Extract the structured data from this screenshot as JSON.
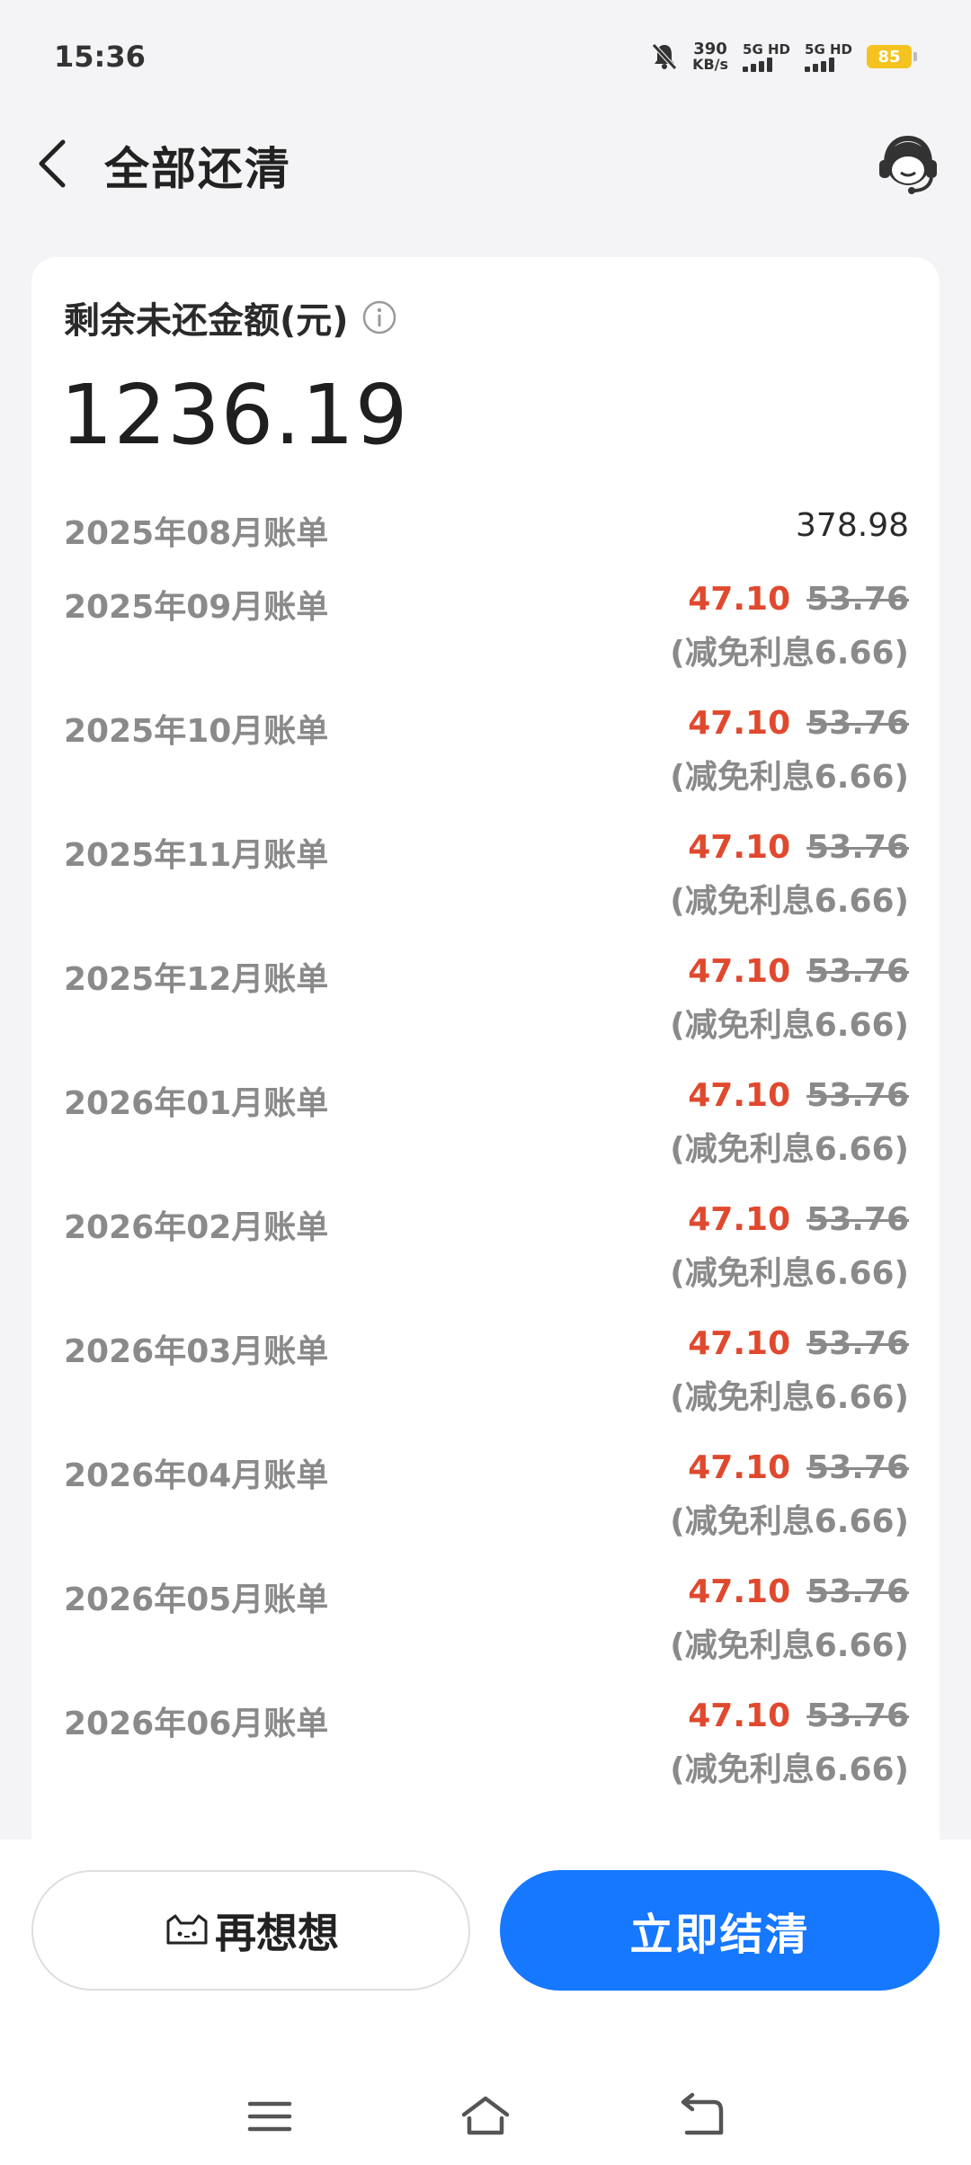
{
  "status_bar": {
    "time": "15:36",
    "net_speed_value": "390",
    "net_speed_unit": "KB/s",
    "sim1_label": "5G HD",
    "sim2_label": "5G HD",
    "battery": "85",
    "icons": [
      "mute-bell-icon",
      "signal-icon",
      "battery-icon"
    ]
  },
  "header": {
    "title": "全部还清",
    "back_icon": "chevron-left-icon",
    "service_icon": "customer-service-icon"
  },
  "balance": {
    "label": "剩余未还金额(元)",
    "amount": "1236.19",
    "info_icon": "info-icon"
  },
  "bills": [
    {
      "month": "2025年08月账单",
      "amount": "378.98"
    },
    {
      "month": "2025年09月账单",
      "amount": "47.10",
      "original": "53.76",
      "saving": "(减免利息6.66)"
    },
    {
      "month": "2025年10月账单",
      "amount": "47.10",
      "original": "53.76",
      "saving": "(减免利息6.66)"
    },
    {
      "month": "2025年11月账单",
      "amount": "47.10",
      "original": "53.76",
      "saving": "(减免利息6.66)"
    },
    {
      "month": "2025年12月账单",
      "amount": "47.10",
      "original": "53.76",
      "saving": "(减免利息6.66)"
    },
    {
      "month": "2026年01月账单",
      "amount": "47.10",
      "original": "53.76",
      "saving": "(减免利息6.66)"
    },
    {
      "month": "2026年02月账单",
      "amount": "47.10",
      "original": "53.76",
      "saving": "(减免利息6.66)"
    },
    {
      "month": "2026年03月账单",
      "amount": "47.10",
      "original": "53.76",
      "saving": "(减免利息6.66)"
    },
    {
      "month": "2026年04月账单",
      "amount": "47.10",
      "original": "53.76",
      "saving": "(减免利息6.66)"
    },
    {
      "month": "2026年05月账单",
      "amount": "47.10",
      "original": "53.76",
      "saving": "(减免利息6.66)"
    },
    {
      "month": "2026年06月账单",
      "amount": "47.10",
      "original": "53.76",
      "saving": "(减免利息6.66)"
    }
  ],
  "actions": {
    "later_label": "再想想",
    "settle_label": "立即结清",
    "later_icon": "cat-face-icon"
  },
  "colors": {
    "accent": "#1677ff",
    "discount": "#e0492e",
    "muted": "#8a8a8a",
    "battery": "#f5c320"
  },
  "nav": {
    "icons": [
      "menu-icon",
      "home-icon",
      "back-icon"
    ]
  }
}
